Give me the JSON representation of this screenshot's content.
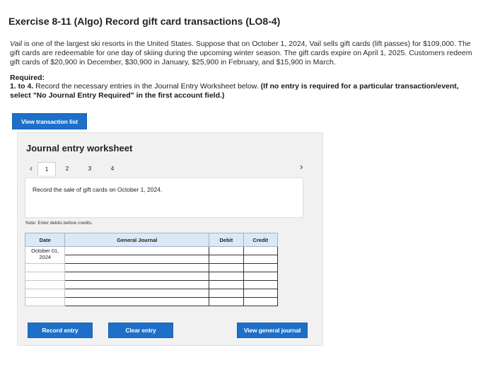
{
  "title": "Exercise 8-11 (Algo) Record gift card transactions (LO8-4)",
  "intro": {
    "company": "Vail",
    "text": " is one of the largest ski resorts in the United States. Suppose that on October 1, 2024, Vail sells gift cards (lift passes) for $109,000. The gift cards are redeemable for one day of skiing during the upcoming winter season. The gift cards expire on April 1, 2025. Customers redeem gift cards of $20,900 in December, $30,900 in January, $25,900 in February, and $15,900 in March."
  },
  "required": {
    "heading": "Required:",
    "prefix": "1. to 4.",
    "text": " Record the necessary entries in the Journal Entry Worksheet below. ",
    "strong": "(If no entry is required for a particular transaction/event, select \"No Journal Entry Required\" in the first account field.)"
  },
  "buttons": {
    "view_transaction_list": "View transaction list",
    "record_entry": "Record entry",
    "clear_entry": "Clear entry",
    "view_general_journal": "View general journal"
  },
  "worksheet": {
    "title": "Journal entry worksheet",
    "tabs": [
      "1",
      "2",
      "3",
      "4"
    ],
    "active_tab": "1",
    "prompt": "Record the sale of gift cards on October 1, 2024.",
    "note": "Note: Enter debits before credits.",
    "table": {
      "headers": [
        "Date",
        "General Journal",
        "Debit",
        "Credit"
      ],
      "date_value": "October 01, 2024"
    }
  },
  "colors": {
    "accent": "#1d6fc9",
    "header_bg": "#dce8f5",
    "panel_bg": "#f1f1f1"
  }
}
